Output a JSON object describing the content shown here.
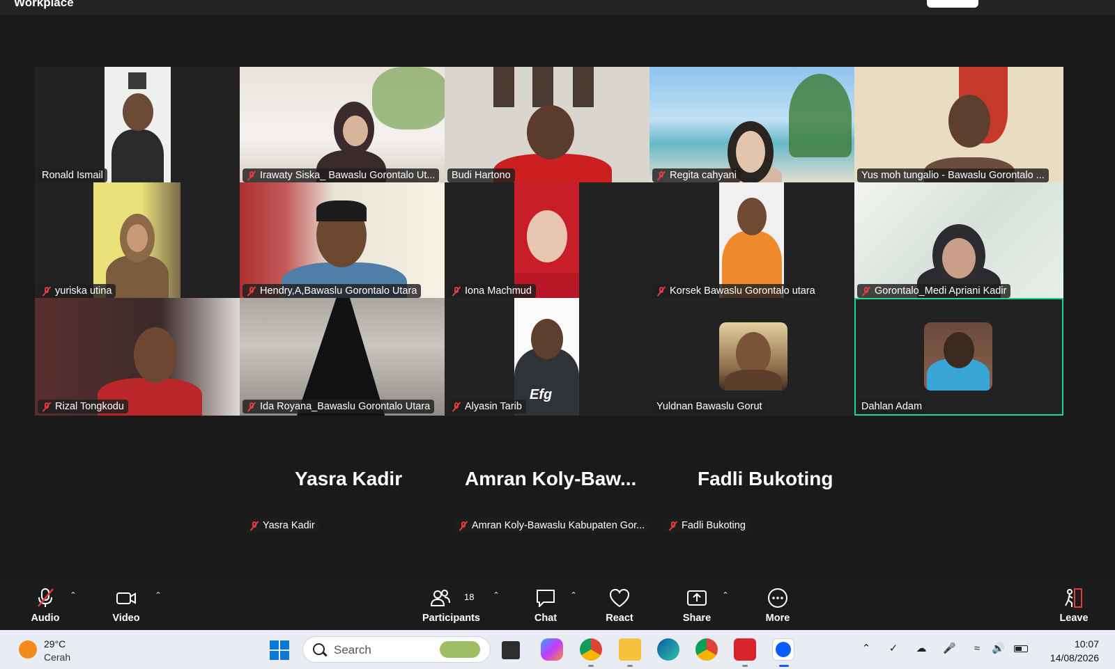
{
  "app": {
    "title": "Workplace"
  },
  "gallery": {
    "tiles": [
      {
        "name": "Ronald Ismail",
        "muted": false
      },
      {
        "name": "Irawaty Siska_ Bawaslu Gorontalo Ut...",
        "muted": true
      },
      {
        "name": "Budi Hartono",
        "muted": false
      },
      {
        "name": "Regita cahyani",
        "muted": true
      },
      {
        "name": "Yus moh tungalio - Bawaslu Gorontalo ...",
        "muted": false
      },
      {
        "name": "yuriska utina",
        "muted": true
      },
      {
        "name": "Hendry,A,Bawaslu Gorontalo Utara",
        "muted": true
      },
      {
        "name": "Iona Machmud",
        "muted": true
      },
      {
        "name": "Korsek Bawaslu Gorontalo utara",
        "muted": true
      },
      {
        "name": "Gorontalo_Medi Apriani Kadir",
        "muted": true
      },
      {
        "name": "Rizal Tongkodu",
        "muted": true
      },
      {
        "name": "Ida Royana_Bawaslu Gorontalo Utara",
        "muted": true
      },
      {
        "name": "Alyasin Tarib",
        "muted": true
      },
      {
        "name": "Yuldnan Bawaslu Gorut",
        "muted": false
      },
      {
        "name": "Dahlan Adam",
        "muted": false
      }
    ],
    "shirt_text": "Efg"
  },
  "name_only": [
    {
      "big": "Yasra Kadir",
      "small": "Yasra Kadir"
    },
    {
      "big": "Amran  Koly-Baw...",
      "small": "Amran Koly-Bawaslu Kabupaten Gor..."
    },
    {
      "big": "Fadli Bukoting",
      "small": "Fadli Bukoting"
    }
  ],
  "toolbar": {
    "audio": "Audio",
    "video": "Video",
    "participants": "Participants",
    "participants_count": "18",
    "chat": "Chat",
    "react": "React",
    "share": "Share",
    "more": "More",
    "leave": "Leave"
  },
  "taskbar": {
    "weather_temp": "29°C",
    "weather_desc": "Cerah",
    "search_placeholder": "Search",
    "time": "10:07",
    "date": "14/08/2026"
  },
  "colors": {
    "active_speaker": "#23d58a",
    "muted": "#e23d3d",
    "toolbar_bg": "#1b1b1b",
    "taskbar_bg": "#e9edf3"
  }
}
